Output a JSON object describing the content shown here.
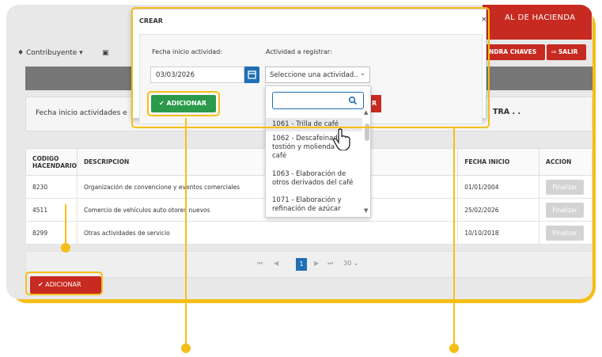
{
  "banner": {
    "text": "AL DE HACIENDA"
  },
  "menubar": {
    "contribuyente": "Contribuyente",
    "user_button": "NDRA CHAVES",
    "salir_button": "SALIR"
  },
  "info": {
    "left_label": "Fecha inicio actividades e",
    "right_label": "TRA . ."
  },
  "table": {
    "headers": [
      "CODIGO HACENDARIO",
      "DESCRIPCION",
      "FECHA INICIO",
      "ACCION"
    ],
    "rows": [
      {
        "code": "8230",
        "desc": "Organización de convencione y eventos comerciales",
        "date": "01/01/2004",
        "action": "Finalizar"
      },
      {
        "code": "4511",
        "desc": "Comercio de vehículos auto otores nuevos",
        "date": "25/02/2026",
        "action": "Finalizar"
      },
      {
        "code": "8299",
        "desc": "Otras actividades de servicio",
        "date": "10/10/2018",
        "action": "Finalizar"
      }
    ]
  },
  "pager": {
    "current_page": "1",
    "page_size": "30"
  },
  "bottom_button": "ADICIONAR",
  "dialog": {
    "title": "CREAR",
    "close": "×",
    "label_date": "Fecha inicio actividad:",
    "label_activity": "Actividad a registrar:",
    "date_value": "03/03/2026",
    "select_value": "Seleccione una actividad..",
    "add_button": "ADICIONAR",
    "red_partial": "R"
  },
  "dropdown": {
    "search_value": "",
    "options": [
      "1061 - Trilla de café",
      "1062 - Descafeinado, tostión y molienda del café",
      "1063 - Elaboración de otros derivados del café",
      "1071 - Elaboración y refinación de azúcar"
    ]
  },
  "colors": {
    "accent": "#f6be16",
    "red": "#c72a20",
    "green": "#2b9a4a",
    "blue": "#1f6fb5"
  }
}
